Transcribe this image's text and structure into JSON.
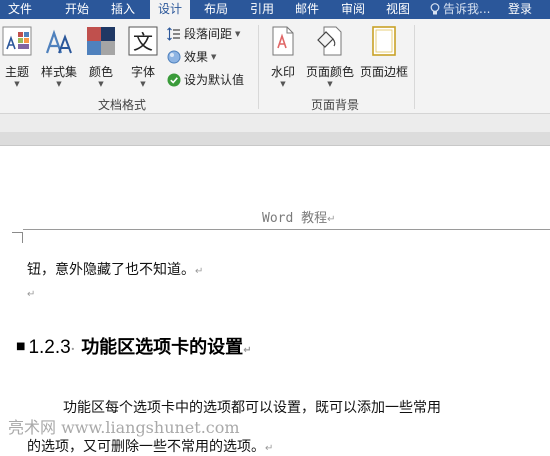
{
  "tabs": {
    "file": "文件",
    "home": "开始",
    "insert": "插入",
    "design": "设计",
    "layout": "布局",
    "references": "引用",
    "mailings": "邮件",
    "review": "审阅",
    "view": "视图"
  },
  "active_tab": "design",
  "tell_me": "告诉我...",
  "login": "登录",
  "ribbon": {
    "doc_format": {
      "themes": "主题",
      "style_set": "样式集",
      "colors": "颜色",
      "fonts": "字体",
      "paragraph_spacing": "段落间距",
      "effects": "效果",
      "set_default": "设为默认值",
      "label": "文档格式"
    },
    "page_background": {
      "watermark": "水印",
      "page_color": "页面颜色",
      "page_borders": "页面边框",
      "label": "页面背景"
    }
  },
  "document": {
    "header_text": "Word 教程",
    "line1": "钮，意外隐藏了也不知道。",
    "heading_number": "1.2.3",
    "heading_text": "功能区选项卡的设置",
    "para_line1": "功能区每个选项卡中的选项都可以设置，既可以添加一些常用",
    "para_line2": "的选项，又可删除一些不常用的选项。",
    "watermark": "亮术网 www.liangshunet.com"
  },
  "colors": {
    "tabbar": "#2b579a",
    "ribbon": "#f3f3f3"
  }
}
